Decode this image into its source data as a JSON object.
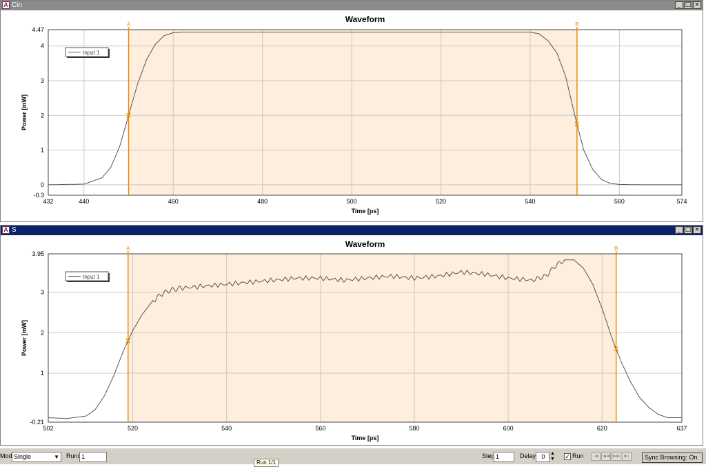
{
  "colors": {
    "cursor": "#f08a00",
    "shade": "#fdeedd",
    "trace": "#555555",
    "grid": "#c8c8c8"
  },
  "windows": [
    {
      "title": "Cin",
      "chart": {
        "title": "Waveform",
        "xlabel": "Time [ps]",
        "ylabel": "Power [mW]",
        "xticks": [
          "432",
          "440",
          "460",
          "480",
          "500",
          "520",
          "540",
          "560",
          "574"
        ],
        "yticks": [
          "4.47",
          "4",
          "3",
          "2",
          "1",
          "0",
          "-0.3"
        ],
        "legend": "Input 1",
        "cursorA": "A",
        "cursorB": "B"
      }
    },
    {
      "title": "S",
      "chart": {
        "title": "Waveform",
        "xlabel": "Time [ps]",
        "ylabel": "Power [mW]",
        "xticks": [
          "502",
          "520",
          "540",
          "560",
          "580",
          "600",
          "620",
          "637"
        ],
        "yticks": [
          "3.95",
          "3",
          "2",
          "1",
          "-0.21"
        ],
        "legend": "Input 1",
        "cursorA": "A",
        "cursorB": "B"
      }
    }
  ],
  "statusbar": {
    "mode_label": "Mode",
    "mode_value": "Single",
    "runs_label": "Runs",
    "runs_value": "1",
    "step_label": "Step",
    "step_value": "1",
    "delay_label": "Delay",
    "delay_value": "0",
    "run_label": "Run",
    "sync": "Sync Browsing: On",
    "tooltip": "Run 1/1"
  },
  "chart_data": [
    {
      "type": "line",
      "title": "Waveform",
      "xlabel": "Time [ps]",
      "ylabel": "Power [mW]",
      "xlim": [
        432,
        574
      ],
      "ylim": [
        -0.3,
        4.47
      ],
      "grid": true,
      "legend": "top-left",
      "cursors": {
        "A": 450,
        "B": 550.5
      },
      "series": [
        {
          "name": "Input 1",
          "x": [
            432,
            440,
            444,
            446,
            448,
            450,
            452,
            454,
            456,
            458,
            460,
            462,
            470,
            480,
            500,
            520,
            540,
            542,
            544,
            546,
            548,
            550,
            552,
            554,
            556,
            558,
            560,
            565,
            574
          ],
          "y": [
            0,
            0.02,
            0.2,
            0.5,
            1.1,
            2.0,
            2.9,
            3.6,
            4.05,
            4.3,
            4.38,
            4.4,
            4.4,
            4.4,
            4.4,
            4.4,
            4.4,
            4.35,
            4.15,
            3.8,
            3.1,
            2.0,
            1.0,
            0.45,
            0.15,
            0.04,
            0.01,
            0,
            0
          ]
        }
      ]
    },
    {
      "type": "line",
      "title": "Waveform",
      "xlabel": "Time [ps]",
      "ylabel": "Power [mW]",
      "xlim": [
        502,
        637
      ],
      "ylim": [
        -0.21,
        3.95
      ],
      "grid": true,
      "legend": "top-left",
      "cursors": {
        "A": 519,
        "B": 623
      },
      "series": [
        {
          "name": "Input 1",
          "x": [
            502,
            506,
            510,
            512,
            514,
            516,
            518,
            520,
            522,
            524,
            526,
            528,
            530,
            535,
            540,
            545,
            550,
            555,
            560,
            565,
            570,
            575,
            580,
            585,
            590,
            595,
            600,
            605,
            608,
            610,
            612,
            614,
            616,
            618,
            620,
            622,
            624,
            626,
            628,
            630,
            632,
            634,
            637
          ],
          "y": [
            -0.1,
            -0.12,
            -0.06,
            0.1,
            0.45,
            0.95,
            1.55,
            2.05,
            2.45,
            2.75,
            2.95,
            3.05,
            3.1,
            3.15,
            3.2,
            3.25,
            3.3,
            3.35,
            3.35,
            3.3,
            3.35,
            3.4,
            3.35,
            3.4,
            3.5,
            3.45,
            3.35,
            3.3,
            3.4,
            3.65,
            3.8,
            3.8,
            3.6,
            3.2,
            2.6,
            1.9,
            1.3,
            0.8,
            0.4,
            0.15,
            -0.02,
            -0.1,
            -0.1
          ]
        }
      ]
    }
  ]
}
